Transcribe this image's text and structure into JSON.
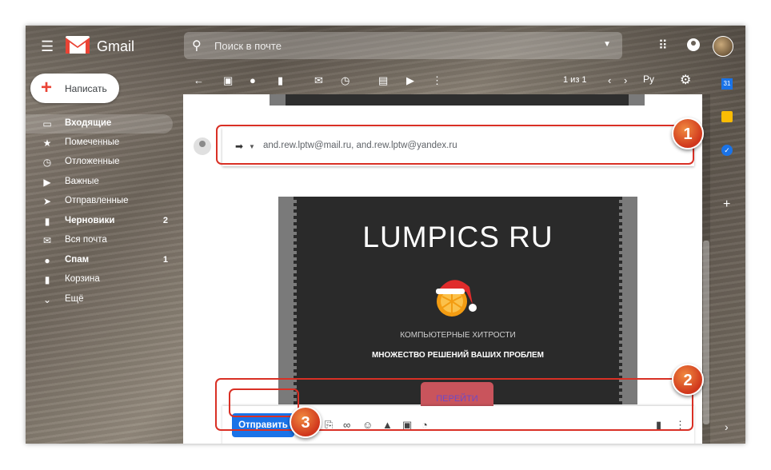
{
  "header": {
    "brand": "Gmail",
    "search_placeholder": "Поиск в почте",
    "pager": "1 из 1",
    "lang": "Ру"
  },
  "compose_button": {
    "label": "Написать"
  },
  "sidebar": {
    "items": [
      {
        "label": "Входящие",
        "icon": "inbox-icon",
        "active": true,
        "bold": true,
        "count": ""
      },
      {
        "label": "Помеченные",
        "icon": "star-icon",
        "bold": false,
        "count": ""
      },
      {
        "label": "Отложенные",
        "icon": "clock-icon",
        "bold": false,
        "count": ""
      },
      {
        "label": "Важные",
        "icon": "important-icon",
        "bold": false,
        "count": ""
      },
      {
        "label": "Отправленные",
        "icon": "send-icon",
        "bold": false,
        "count": ""
      },
      {
        "label": "Черновики",
        "icon": "draft-icon",
        "bold": true,
        "count": "2"
      },
      {
        "label": "Вся почта",
        "icon": "mail-icon",
        "bold": false,
        "count": ""
      },
      {
        "label": "Спам",
        "icon": "spam-icon",
        "bold": true,
        "count": "1"
      },
      {
        "label": "Корзина",
        "icon": "trash-icon",
        "bold": false,
        "count": ""
      },
      {
        "label": "Ещё",
        "icon": "chevron-down-icon",
        "bold": false,
        "count": ""
      }
    ]
  },
  "message": {
    "recipients": "and.rew.lptw@mail.ru, and.rew.lptw@yandex.ru",
    "card": {
      "title": "LUMPICS RU",
      "subtitle": "КОМПЬЮТЕРНЫЕ ХИТРОСТИ",
      "tagline": "МНОЖЕСТВО РЕШЕНИЙ ВАШИХ ПРОБЛЕМ",
      "button": "ПЕРЕЙТИ"
    }
  },
  "compose_bar": {
    "send_label": "Отправить"
  },
  "annotations": {
    "one": "1",
    "two": "2",
    "three": "3"
  },
  "colors": {
    "accent": "#1a73e8",
    "annotation": "#d93025",
    "card_bg": "#2a2a2a"
  }
}
